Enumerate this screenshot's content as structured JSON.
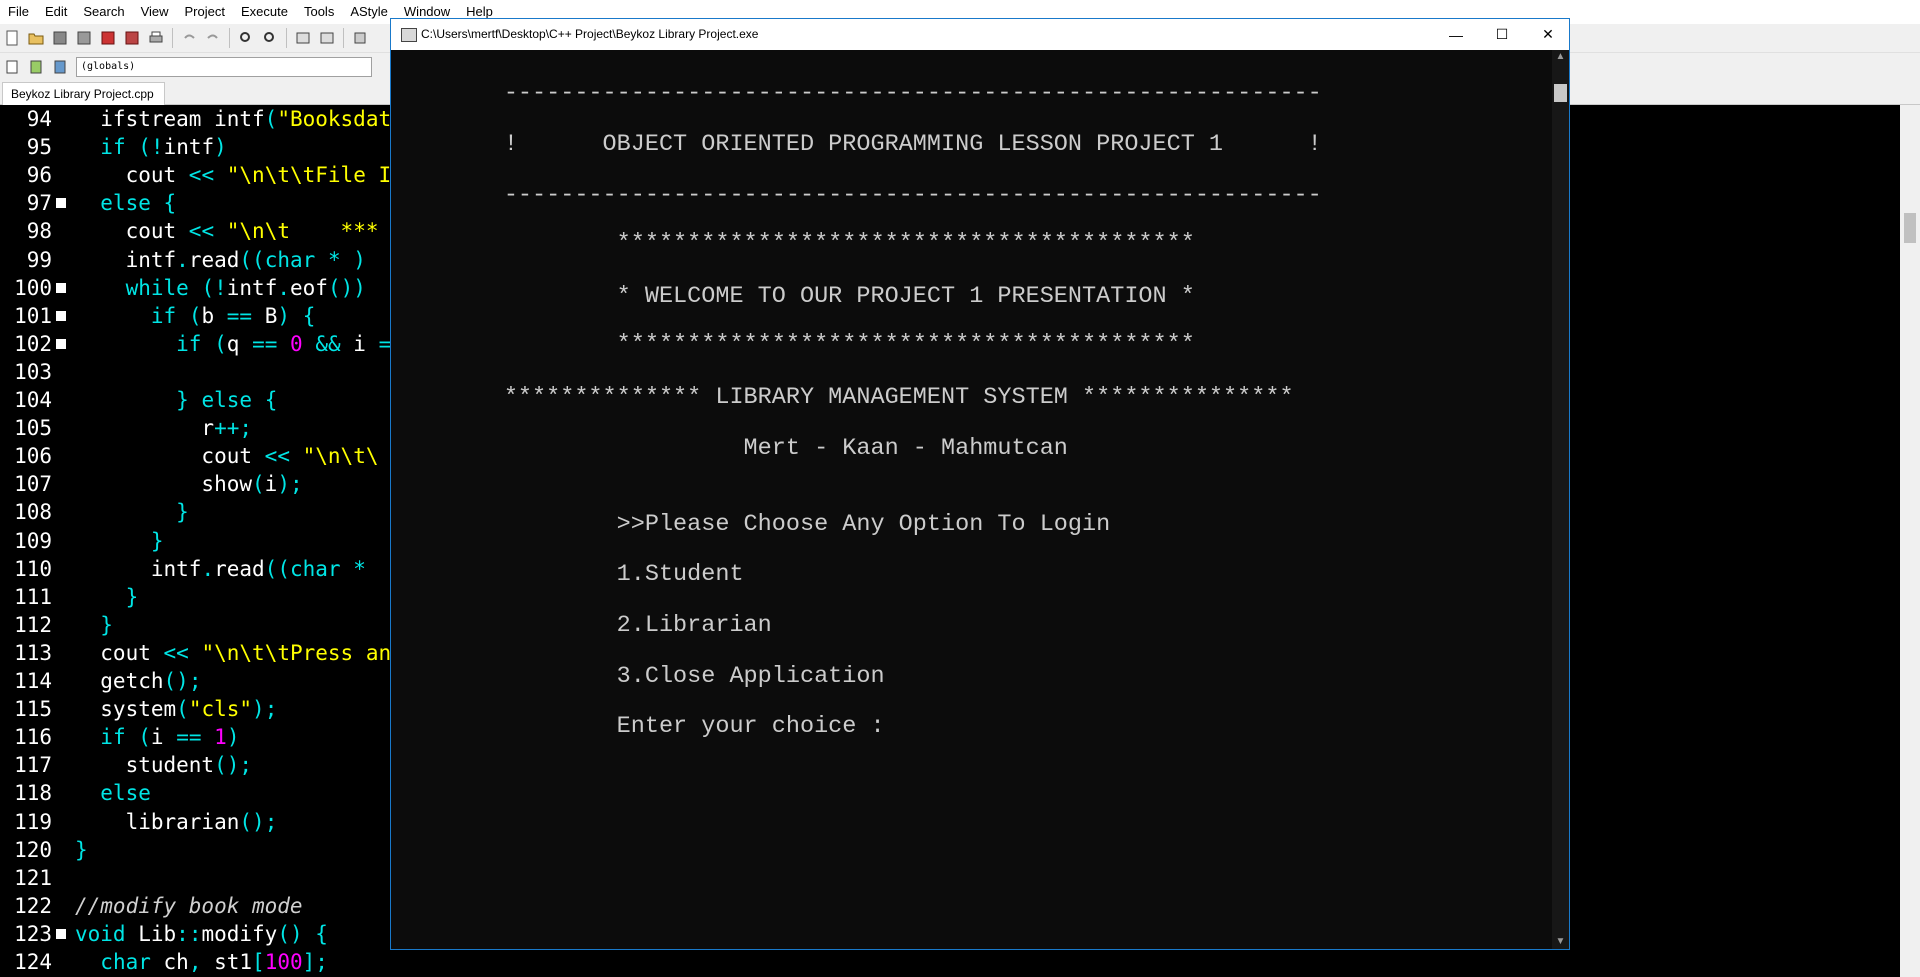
{
  "ide": {
    "menu": [
      "File",
      "Edit",
      "Search",
      "View",
      "Project",
      "Execute",
      "Tools",
      "AStyle",
      "Window",
      "Help"
    ],
    "globals_label": "(globals)",
    "tab_label": "Beykoz Library Project.cpp"
  },
  "editor": {
    "lines": [
      {
        "n": "94",
        "code": "  ifstream intf(\"Booksdat",
        "fold": false
      },
      {
        "n": "95",
        "code": "  if (!intf)",
        "fold": false
      },
      {
        "n": "96",
        "code": "    cout << \"\\n\\t\\tFile I",
        "fold": false
      },
      {
        "n": "97",
        "code": "  else {",
        "fold": true
      },
      {
        "n": "98",
        "code": "    cout << \"\\n\\t    ***",
        "fold": false
      },
      {
        "n": "99",
        "code": "    intf.read((char * ) ",
        "fold": false
      },
      {
        "n": "100",
        "code": "    while (!intf.eof()) ",
        "fold": true
      },
      {
        "n": "101",
        "code": "      if (b == B) {",
        "fold": true
      },
      {
        "n": "102",
        "code": "        if (q == 0 && i =",
        "fold": true
      },
      {
        "n": "103",
        "code": "",
        "fold": false
      },
      {
        "n": "104",
        "code": "        } else {",
        "fold": false
      },
      {
        "n": "105",
        "code": "          r++;",
        "fold": false
      },
      {
        "n": "106",
        "code": "          cout << \"\\n\\t\\",
        "fold": false
      },
      {
        "n": "107",
        "code": "          show(i);",
        "fold": false
      },
      {
        "n": "108",
        "code": "        }",
        "fold": false
      },
      {
        "n": "109",
        "code": "      }",
        "fold": false
      },
      {
        "n": "110",
        "code": "      intf.read((char * ",
        "fold": false
      },
      {
        "n": "111",
        "code": "    }",
        "fold": false
      },
      {
        "n": "112",
        "code": "  }",
        "fold": false
      },
      {
        "n": "113",
        "code": "  cout << \"\\n\\t\\tPress an",
        "fold": false
      },
      {
        "n": "114",
        "code": "  getch();",
        "fold": false
      },
      {
        "n": "115",
        "code": "  system(\"cls\");",
        "fold": false
      },
      {
        "n": "116",
        "code": "  if (i == 1)",
        "fold": false
      },
      {
        "n": "117",
        "code": "    student();",
        "fold": false
      },
      {
        "n": "118",
        "code": "  else",
        "fold": false
      },
      {
        "n": "119",
        "code": "    librarian();",
        "fold": false
      },
      {
        "n": "120",
        "code": "}",
        "fold": false
      },
      {
        "n": "121",
        "code": "",
        "fold": false
      },
      {
        "n": "122",
        "code": "//modify book mode",
        "fold": false
      },
      {
        "n": "123",
        "code": "void Lib::modify() {",
        "fold": true
      },
      {
        "n": "124",
        "code": "  char ch, st1[100];",
        "fold": false
      }
    ]
  },
  "console": {
    "title": "C:\\Users\\mertf\\Desktop\\C++ Project\\Beykoz Library Project.exe",
    "lines": [
      {
        "text": "        ----------------------------------------------------------",
        "row": 0
      },
      {
        "text": "        !      OBJECT ORIENTED PROGRAMMING LESSON PROJECT 1      !",
        "row": 1
      },
      {
        "text": "        ----------------------------------------------------------",
        "row": 2
      },
      {
        "text": "                *****************************************",
        "row": 3
      },
      {
        "text": "                * WELCOME TO OUR PROJECT 1 PRESENTATION *",
        "row": 4
      },
      {
        "text": "                *****************************************",
        "row": 5
      },
      {
        "text": "        ************** LIBRARY MANAGEMENT SYSTEM ***************",
        "row": 6
      },
      {
        "text": "                         Mert - Kaan - Mahmutcan",
        "row": 7
      },
      {
        "text": "                >>Please Choose Any Option To Login",
        "row": 8
      },
      {
        "text": "                1.Student",
        "row": 9
      },
      {
        "text": "                2.Librarian",
        "row": 10
      },
      {
        "text": "                3.Close Application",
        "row": 11
      },
      {
        "text": "                Enter your choice :",
        "row": 12
      }
    ]
  }
}
